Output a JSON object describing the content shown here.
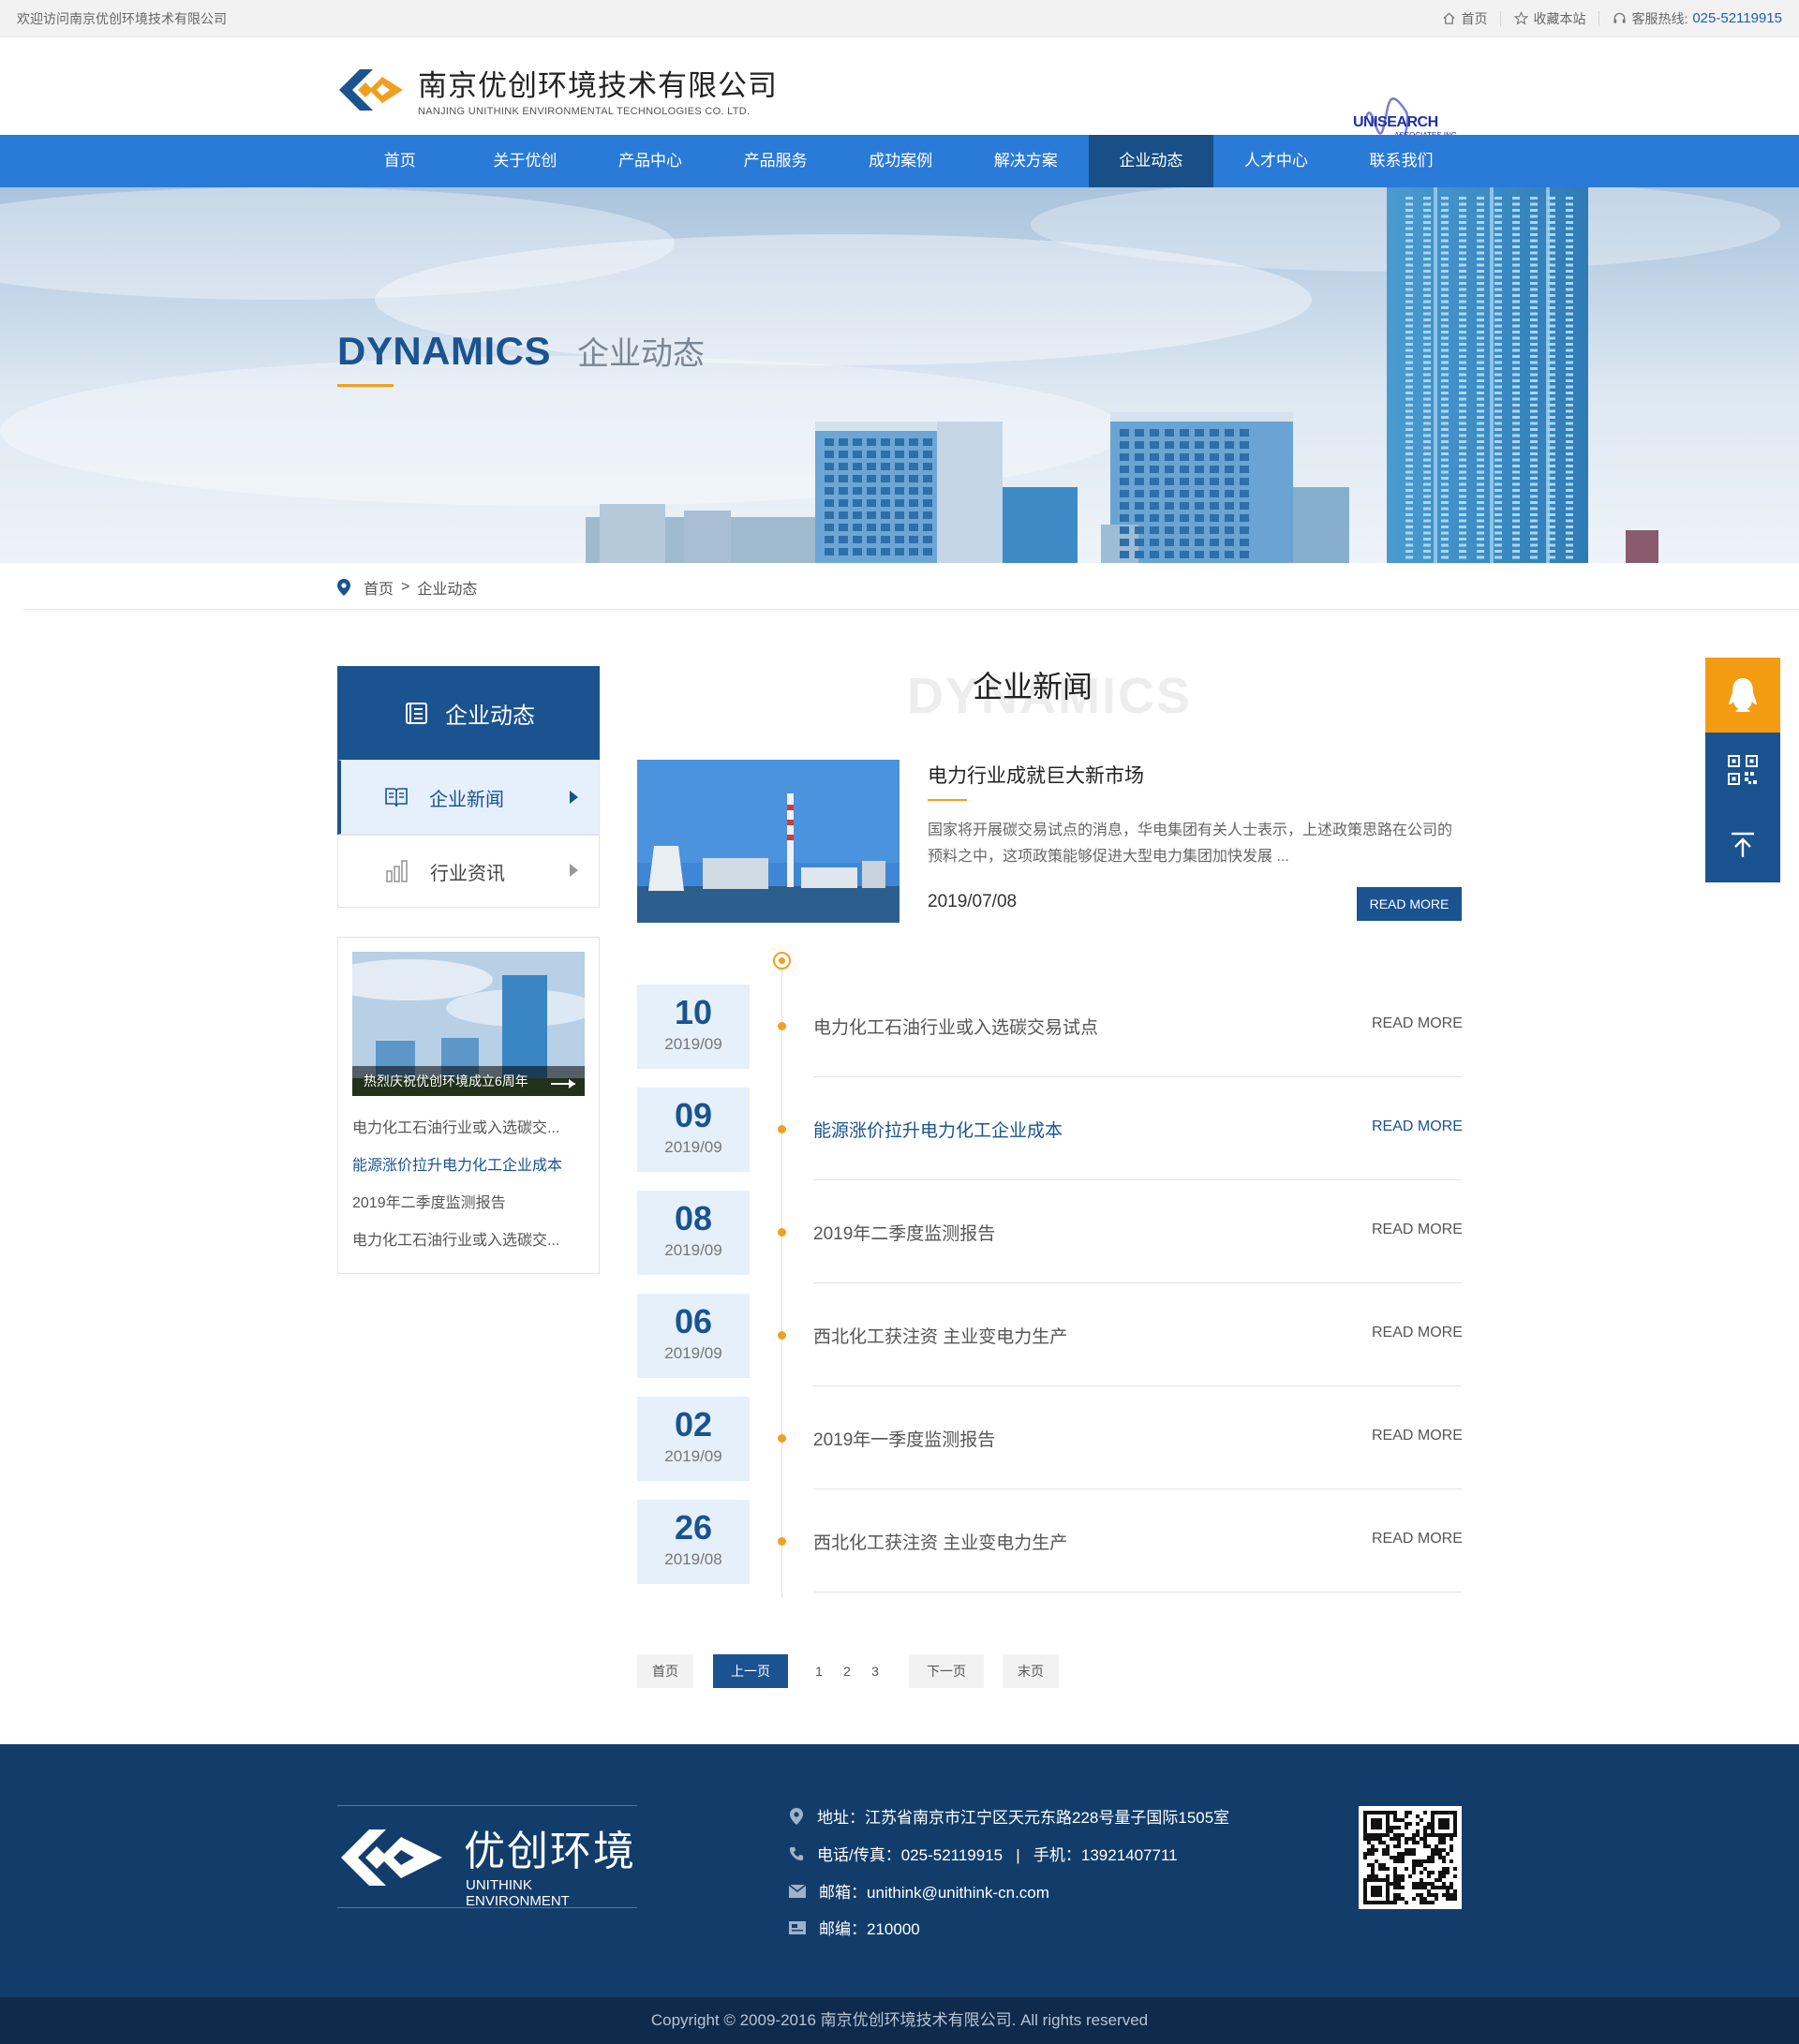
{
  "topbar": {
    "welcome": "欢迎访问南京优创环境技术有限公司",
    "home": "首页",
    "favorite": "收藏本站",
    "hotline_label": "客服热线:",
    "hotline_number": "025-52119915"
  },
  "header": {
    "company_cn": "南京优创环境技术有限公司",
    "company_en": "NANJING UNITHINK ENVIRONMENTAL TECHNOLOGIES CO. LTD.",
    "partner_name": "UNISEARCH",
    "partner_sub": "ASSOCIATES INC"
  },
  "nav": {
    "items": [
      "首页",
      "关于优创",
      "产品中心",
      "产品服务",
      "成功案例",
      "解决方案",
      "企业动态",
      "人才中心",
      "联系我们"
    ],
    "active_index": 6
  },
  "banner": {
    "title_en": "DYNAMICS",
    "title_cn": "企业动态"
  },
  "breadcrumb": {
    "home": "首页",
    "separator": ">",
    "current": "企业动态"
  },
  "sidebar": {
    "heading": "企业动态",
    "items": [
      {
        "label": "企业新闻",
        "active": true
      },
      {
        "label": "行业资讯",
        "active": false
      }
    ],
    "feature_caption": "热烈庆祝优创环境成立6周年",
    "links": [
      {
        "text": "电力化工石油行业或入选碳交...",
        "highlight": false
      },
      {
        "text": "能源涨价拉升电力化工企业成本",
        "highlight": true
      },
      {
        "text": "2019年二季度监测报告",
        "highlight": false
      },
      {
        "text": "电力化工石油行业或入选碳交...",
        "highlight": false
      }
    ]
  },
  "main": {
    "title_bg": "DYNAMICS",
    "title": "企业新闻",
    "featured": {
      "title": "电力行业成就巨大新市场",
      "desc": "国家将开展碳交易试点的消息，华电集团有关人士表示，上述政策思路在公司的预料之中，这项政策能够促进大型电力集团加快发展 ...",
      "date": "2019/07/08",
      "button": "READ MORE"
    },
    "news": [
      {
        "day": "10",
        "ym": "2019/09",
        "title": "电力化工石油行业或入选碳交易试点",
        "more": "READ MORE",
        "highlight": false
      },
      {
        "day": "09",
        "ym": "2019/09",
        "title": "能源涨价拉升电力化工企业成本",
        "more": "READ MORE",
        "highlight": true
      },
      {
        "day": "08",
        "ym": "2019/09",
        "title": "2019年二季度监测报告",
        "more": "READ MORE",
        "highlight": false
      },
      {
        "day": "06",
        "ym": "2019/09",
        "title": "西北化工获注资 主业变电力生产",
        "more": "READ MORE",
        "highlight": false
      },
      {
        "day": "02",
        "ym": "2019/09",
        "title": "2019年一季度监测报告",
        "more": "READ MORE",
        "highlight": false
      },
      {
        "day": "26",
        "ym": "2019/08",
        "title": "西北化工获注资 主业变电力生产",
        "more": "READ MORE",
        "highlight": false
      }
    ]
  },
  "pagination": {
    "first": "首页",
    "prev": "上一页",
    "pages": [
      "1",
      "2",
      "3"
    ],
    "next": "下一页",
    "last": "末页"
  },
  "footer": {
    "brand_cn": "优创环境",
    "brand_en": "UNITHINK ENVIRONMENT",
    "address": "地址：江苏省南京市江宁区天元东路228号量子国际1505室",
    "phone": "电话/传真：025-52119915   |   手机：13921407711",
    "email": "邮箱：unithink@unithink-cn.com",
    "postcode": "邮编：210000",
    "copyright": "Copyright © 2009-2016 南京优创环境技术有限公司. All rights reserved"
  },
  "colors": {
    "nav_blue": "#2a7ad8",
    "dark_blue": "#1a5390",
    "accent_orange": "#f0a020",
    "footer_blue": "#123d6b"
  }
}
